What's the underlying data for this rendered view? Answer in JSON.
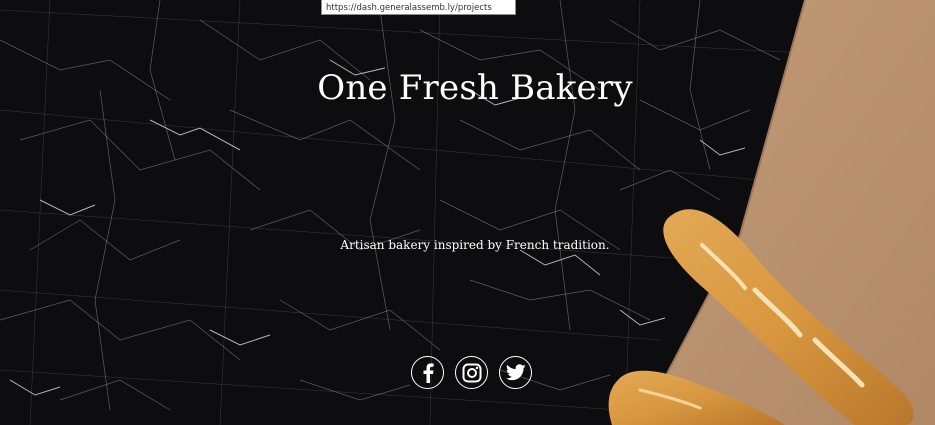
{
  "tooltip": {
    "url": "https://dash.generalassemb.ly/projects"
  },
  "hero": {
    "title": "One Fresh Bakery",
    "tagline": "Artisan bakery inspired by French tradition."
  },
  "social": {
    "items": [
      {
        "name": "facebook",
        "icon": "facebook-icon"
      },
      {
        "name": "instagram",
        "icon": "instagram-icon"
      },
      {
        "name": "twitter",
        "icon": "twitter-icon"
      }
    ]
  },
  "colors": {
    "background": "#0c0c0d",
    "paper": "#b89272",
    "bread": "#d79a45",
    "text": "#ffffff"
  }
}
